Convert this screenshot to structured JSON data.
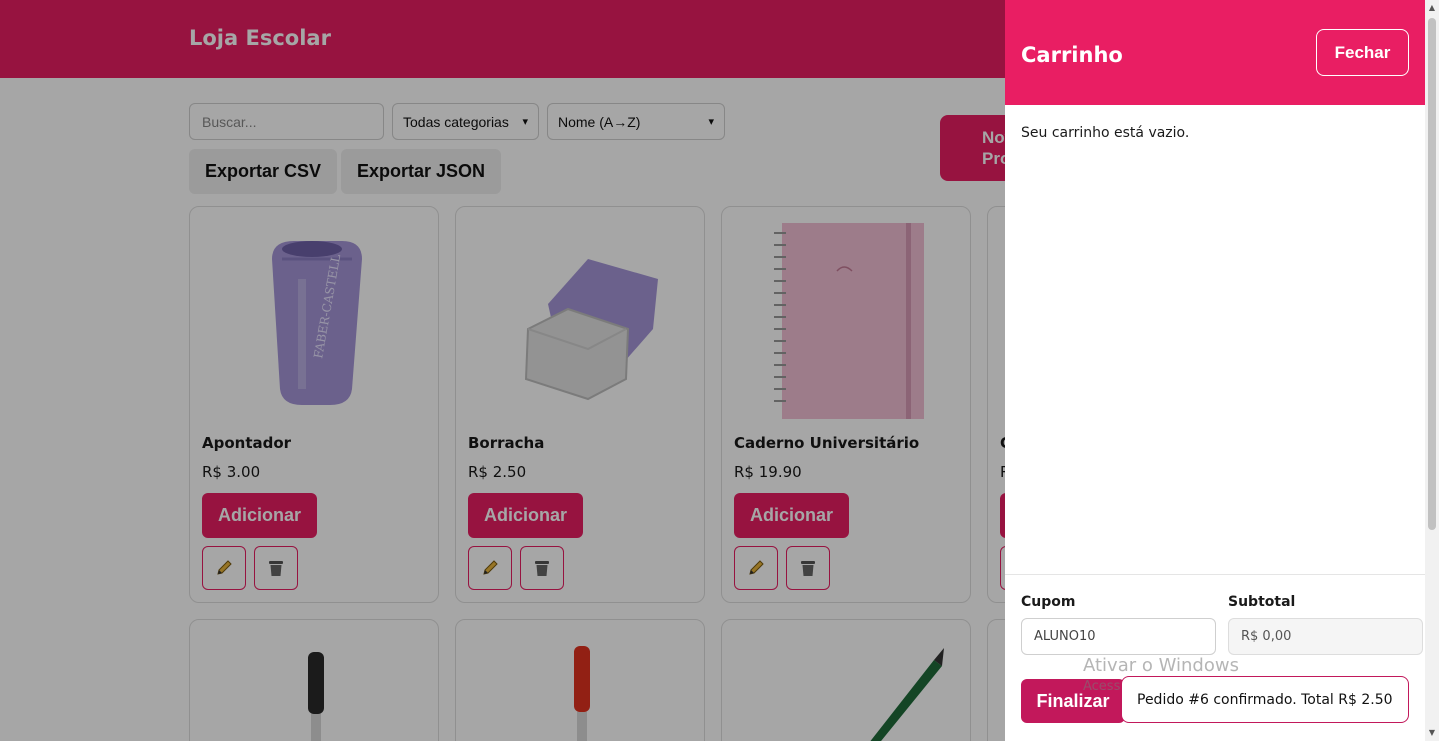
{
  "header": {
    "title": "Loja Escolar"
  },
  "toolbar": {
    "search_placeholder": "Buscar...",
    "category_select": "Todas categorias",
    "sort_select": "Nome (A→Z)",
    "export_csv": "Exportar CSV",
    "export_json": "Exportar JSON",
    "new_product": "Novo Produto"
  },
  "products": [
    {
      "name": "Apontador",
      "price": "R$ 3.00",
      "add_label": "Adicionar",
      "image": "sharpener-image"
    },
    {
      "name": "Borracha",
      "price": "R$ 2.50",
      "add_label": "Adicionar",
      "image": "eraser-image"
    },
    {
      "name": "Caderno Universitário",
      "price": "R$ 19.90",
      "add_label": "Adicionar",
      "image": "notebook-image"
    },
    {
      "name": "C",
      "price": "R",
      "add_label": "Adicionar",
      "image": "product-image"
    }
  ],
  "products_row2": [
    {
      "image": "black-pen-image"
    },
    {
      "image": "red-pen-image"
    },
    {
      "image": "pencil-image"
    },
    {
      "image": "product-image"
    }
  ],
  "cart": {
    "title": "Carrinho",
    "close_label": "Fechar",
    "empty_message": "Seu carrinho está vazio.",
    "coupon_label": "Cupom",
    "coupon_value": "ALUNO10",
    "subtotal_label": "Subtotal",
    "subtotal_value": "R$ 0,00",
    "finalize_label": "Finalizar"
  },
  "toast": {
    "message": "Pedido #6 confirmado. Total R$ 2.50"
  },
  "watermark": {
    "title": "Ativar o Windows",
    "subtitle": "Acesse Configurações para ativar o Windows."
  },
  "colors": {
    "primary": "#e91e63",
    "primary_dark": "#c2185b",
    "overlay": "rgba(0,0,0,0.35)"
  }
}
